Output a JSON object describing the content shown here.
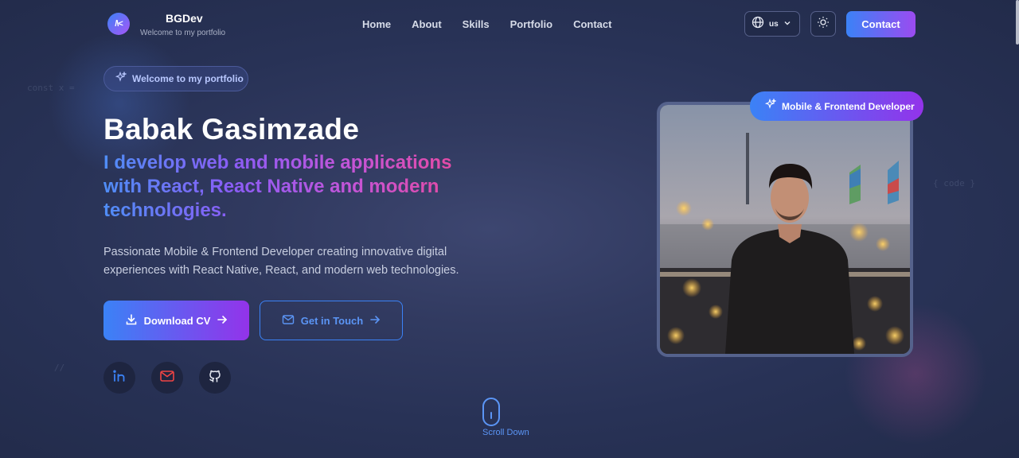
{
  "brand": {
    "logo_glyph": "/\\<",
    "name": "BGDev",
    "subtitle": "Welcome to my portfolio"
  },
  "nav": {
    "items": [
      {
        "label": "Home"
      },
      {
        "label": "About"
      },
      {
        "label": "Skills"
      },
      {
        "label": "Portfolio"
      },
      {
        "label": "Contact"
      }
    ],
    "language": {
      "code": "us",
      "icon": "globe-icon"
    },
    "theme_icon": "sun-icon",
    "contact_label": "Contact"
  },
  "hero": {
    "welcome_pill": "Welcome to my portfolio",
    "name": "Babak Gasimzade",
    "tagline": "I develop web and mobile applications with React, React Native and modern technologies.",
    "description": "Passionate Mobile & Frontend Developer creating innovative digital experiences with React Native, React, and modern web technologies.",
    "download_label": "Download CV",
    "touch_label": "Get in Touch",
    "role_pill": "Mobile & Frontend Developer",
    "social": [
      {
        "name": "linkedin-icon"
      },
      {
        "name": "mail-icon"
      },
      {
        "name": "github-icon"
      }
    ]
  },
  "scroll": {
    "label": "Scroll Down"
  },
  "background_code": [
    "const x =",
    "{ code }",
    "//"
  ],
  "colors": {
    "accent_blue": "#3b82f6",
    "accent_purple": "#9333ea",
    "accent_pink": "#ec4899",
    "background": "#2b3458"
  }
}
